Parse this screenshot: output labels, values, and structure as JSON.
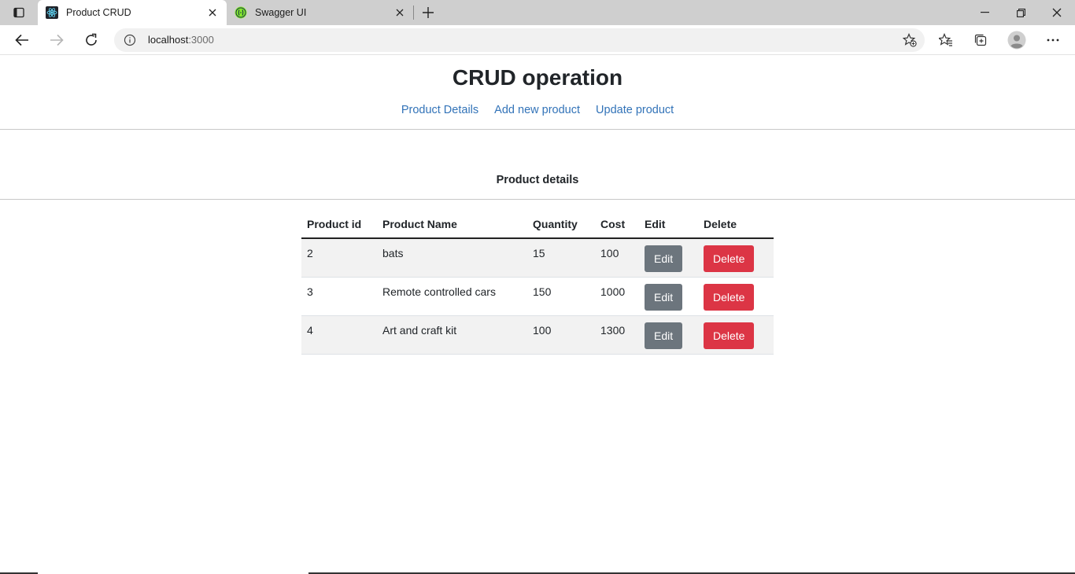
{
  "browser": {
    "tabs": [
      {
        "title": "Product CRUD",
        "icon": "react-icon",
        "active": true
      },
      {
        "title": "Swagger UI",
        "icon": "swagger-icon",
        "active": false
      }
    ],
    "url_host": "localhost",
    "url_port": ":3000"
  },
  "app": {
    "title": "CRUD operation",
    "nav": [
      "Product Details",
      "Add new product",
      "Update product"
    ],
    "section_title": "Product details"
  },
  "table": {
    "headers": [
      "Product id",
      "Product Name",
      "Quantity",
      "Cost",
      "Edit",
      "Delete"
    ],
    "rows": [
      {
        "id": "2",
        "name": "bats",
        "quantity": "15",
        "cost": "100"
      },
      {
        "id": "3",
        "name": "Remote controlled cars",
        "quantity": "150",
        "cost": "1000"
      },
      {
        "id": "4",
        "name": "Art and craft kit",
        "quantity": "100",
        "cost": "1300"
      }
    ],
    "edit_label": "Edit",
    "delete_label": "Delete"
  },
  "colors": {
    "link": "#3273b8",
    "edit_button": "#6c757d",
    "delete_button": "#dc3545"
  }
}
